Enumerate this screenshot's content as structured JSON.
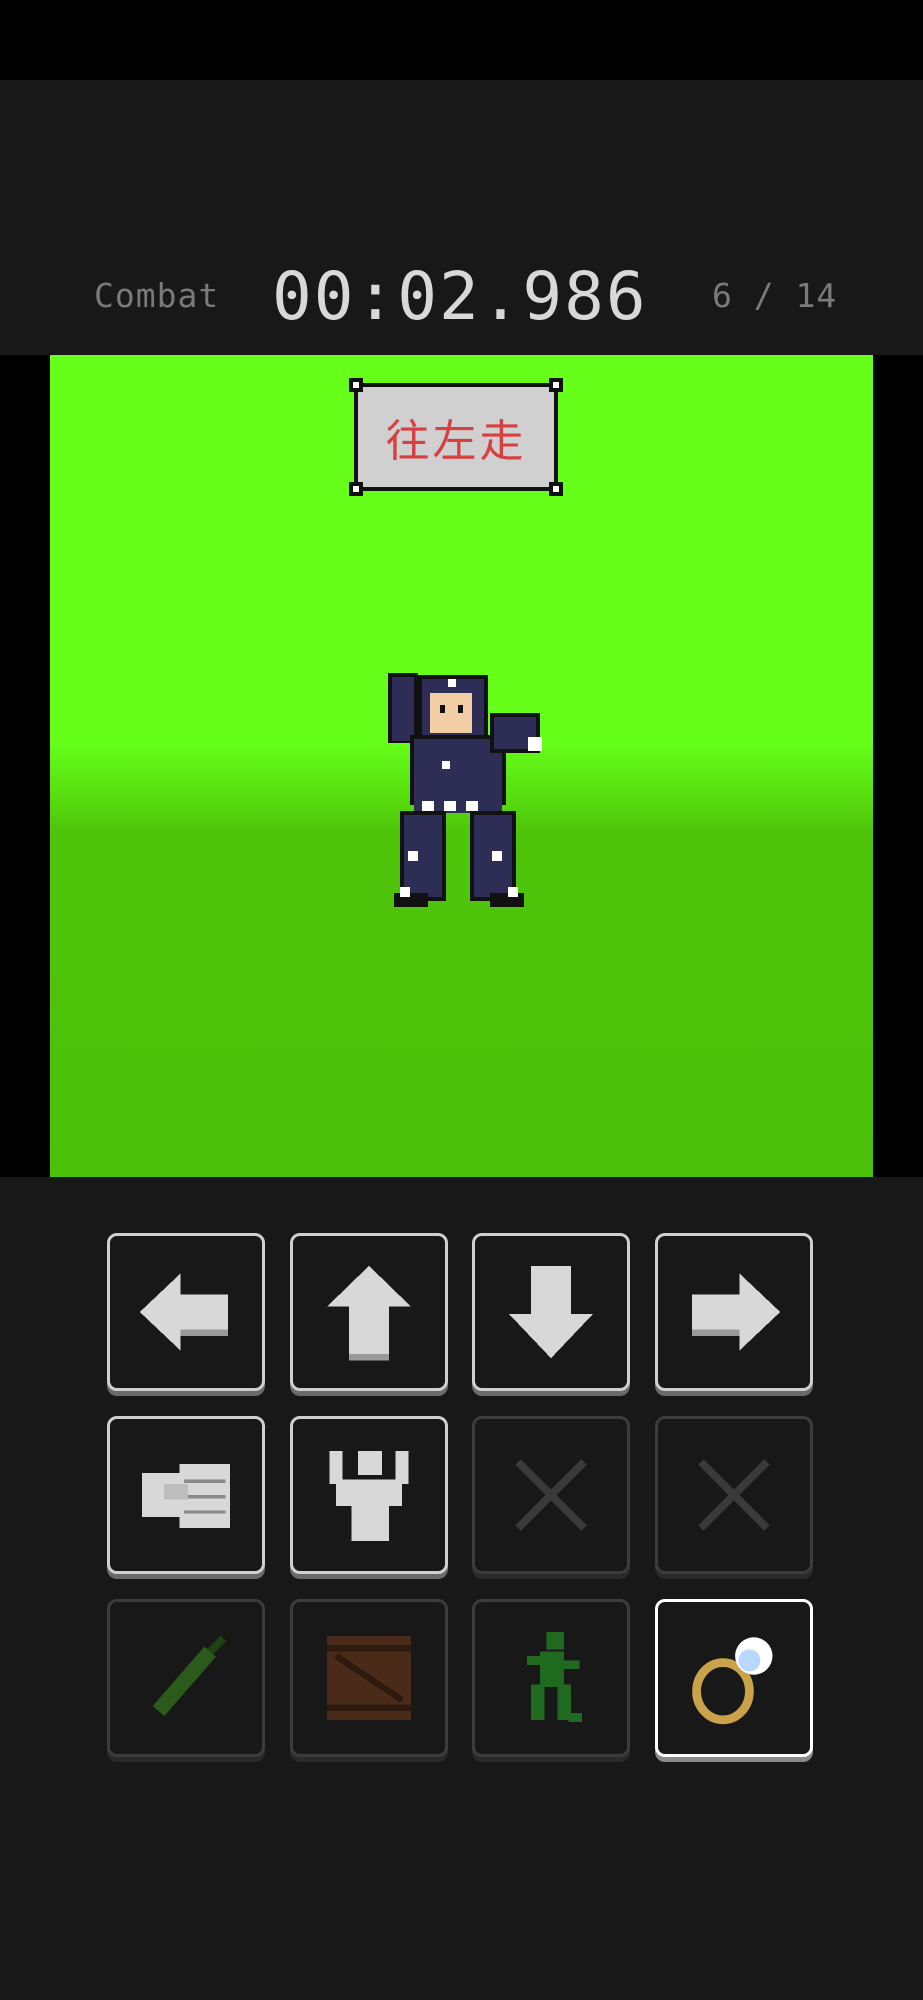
{
  "hud": {
    "mode": "Combat",
    "timer": "00:02.986",
    "progress": "6 / 14"
  },
  "stage": {
    "command_sign": "往左走",
    "character": "ninja-figure"
  },
  "controls": {
    "rows": [
      [
        {
          "icon": "arrow-left-icon",
          "state": "enabled"
        },
        {
          "icon": "arrow-up-icon",
          "state": "enabled"
        },
        {
          "icon": "arrow-down-icon",
          "state": "enabled"
        },
        {
          "icon": "arrow-right-icon",
          "state": "enabled"
        }
      ],
      [
        {
          "icon": "fist-icon",
          "state": "enabled"
        },
        {
          "icon": "flex-icon",
          "state": "enabled"
        },
        {
          "icon": "x-icon",
          "state": "disabled"
        },
        {
          "icon": "x-icon",
          "state": "disabled"
        }
      ],
      [
        {
          "icon": "bottle-icon",
          "state": "disabled"
        },
        {
          "icon": "crate-icon",
          "state": "disabled"
        },
        {
          "icon": "walking-man-icon",
          "state": "disabled"
        },
        {
          "icon": "ring-icon",
          "state": "selected"
        }
      ]
    ]
  },
  "colors": {
    "background": "#181818",
    "stage_green": "#66ff1a",
    "sign_text": "#d64040"
  }
}
